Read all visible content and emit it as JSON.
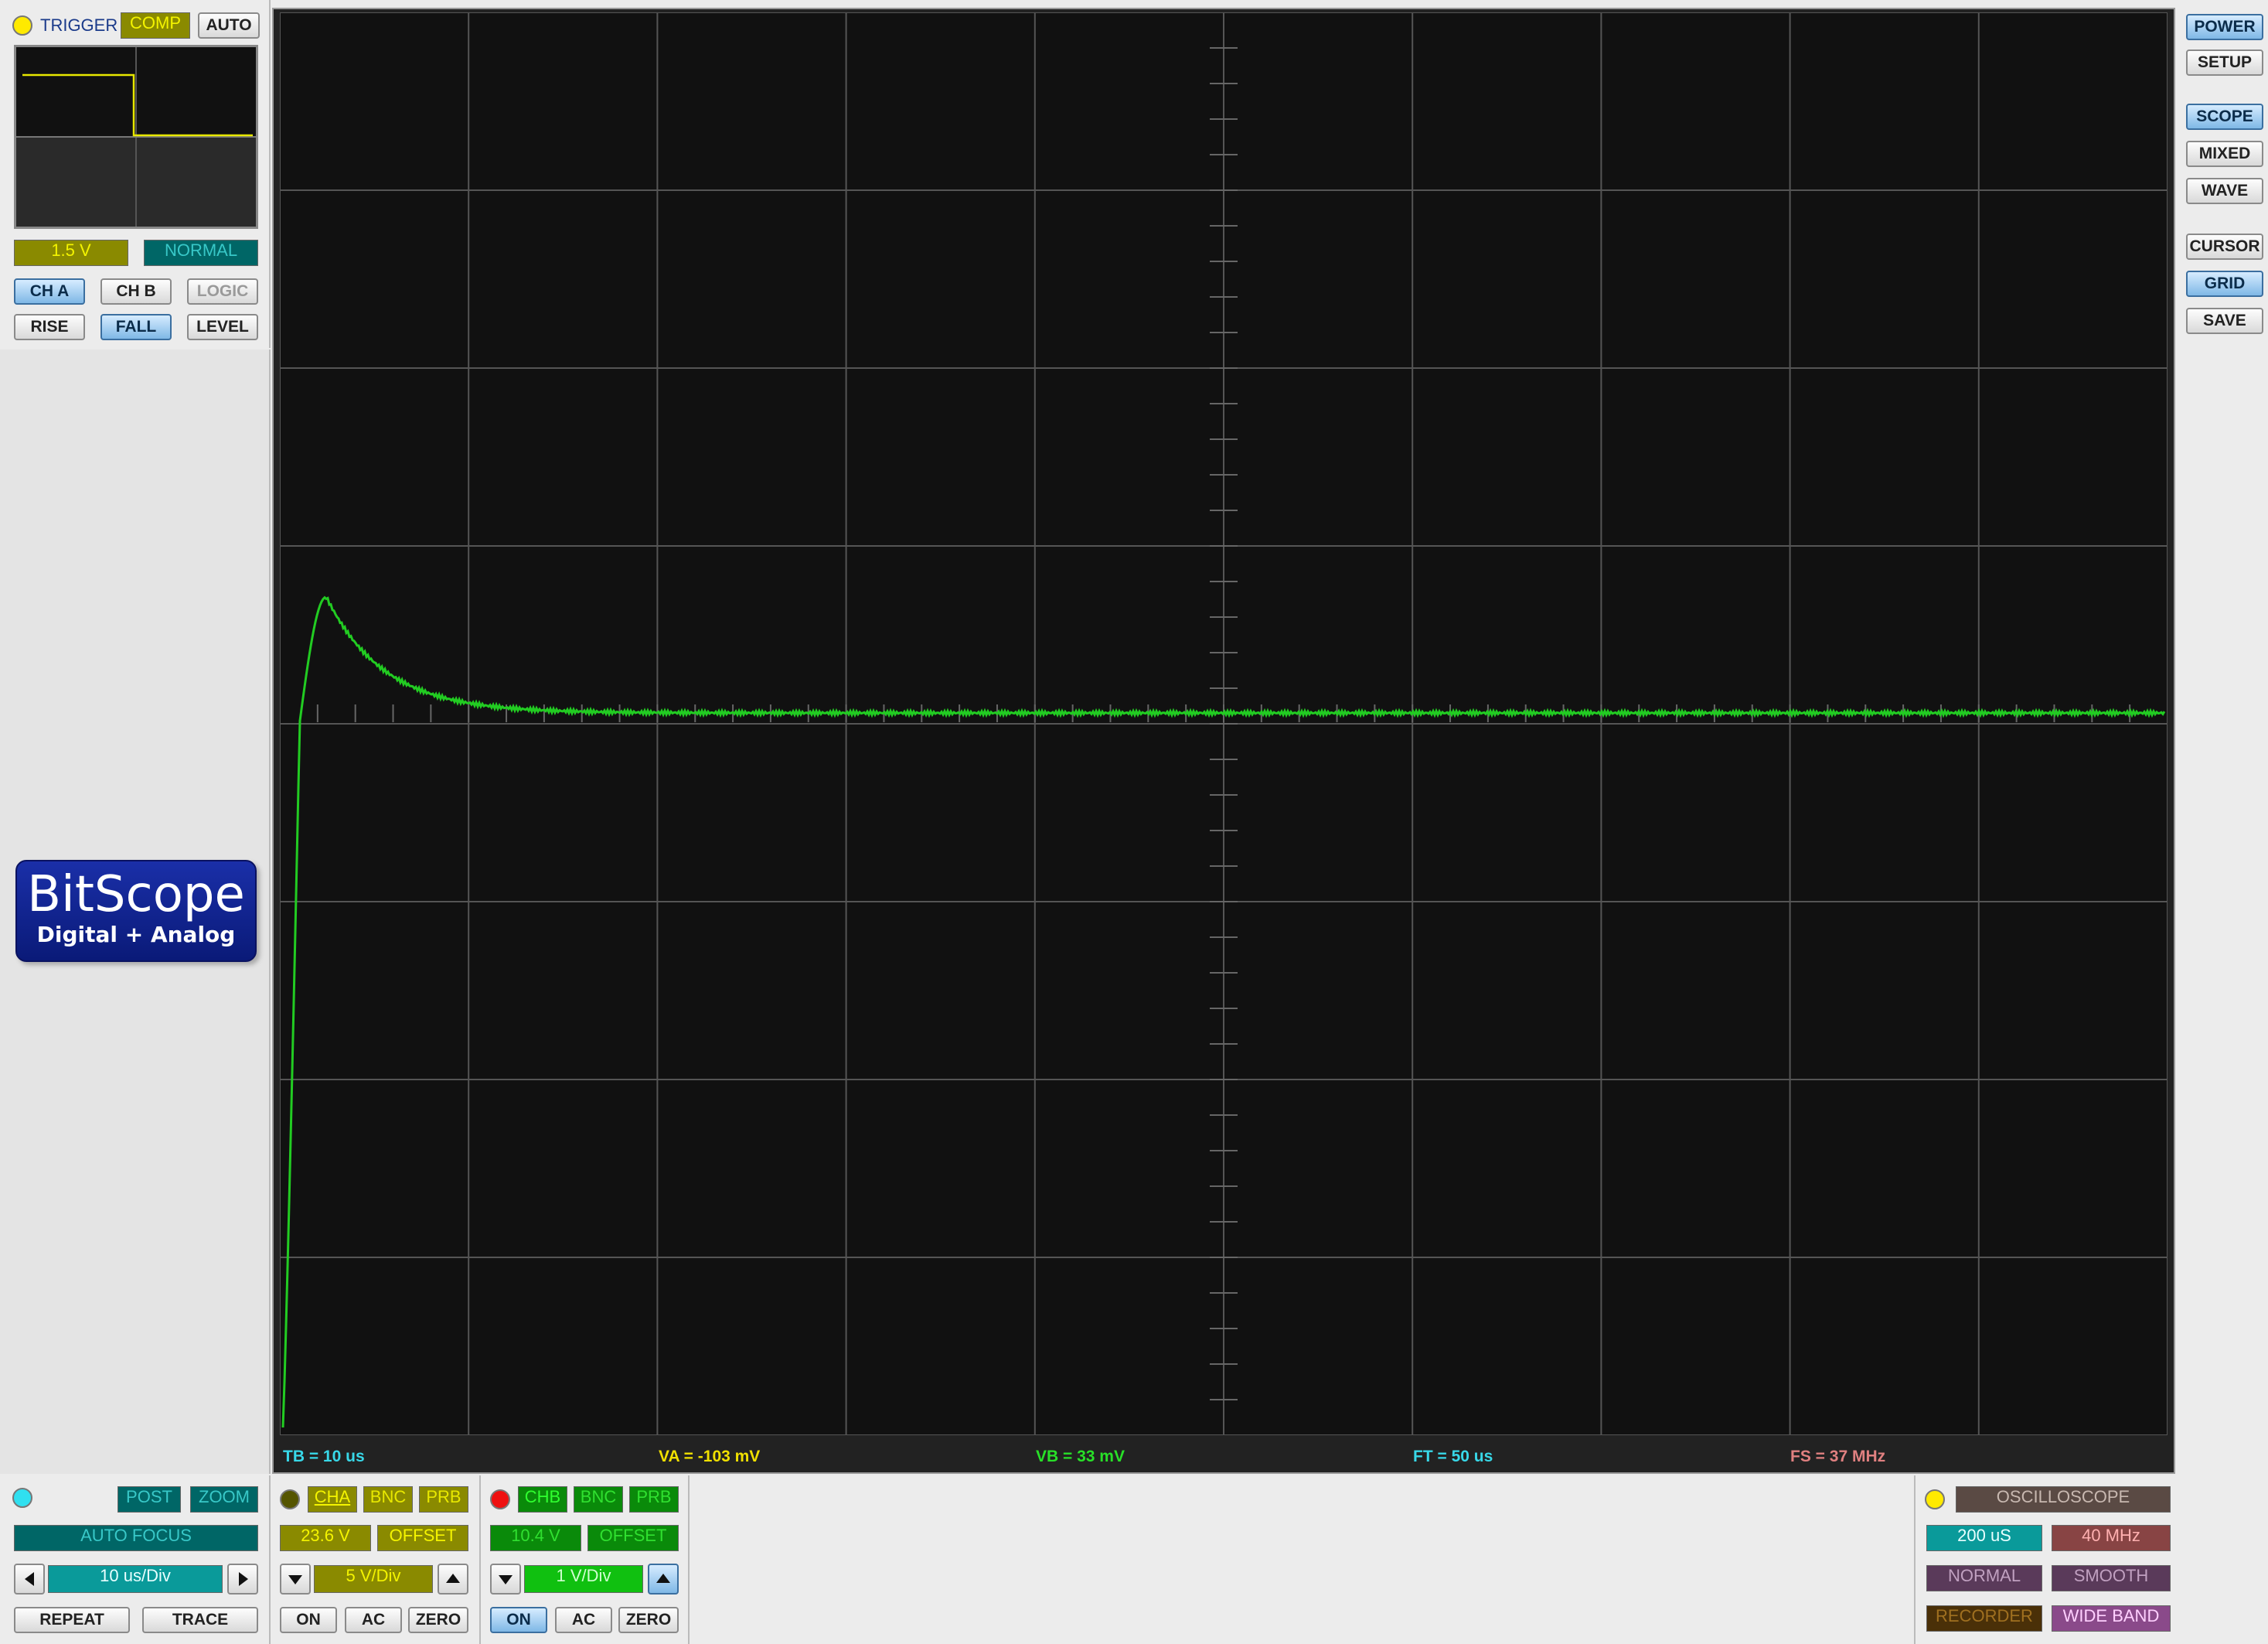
{
  "trigger": {
    "title": "TRIGGER",
    "comp": "COMP",
    "auto": "AUTO",
    "level": "1.5 V",
    "mode": "NORMAL",
    "ch_a": "CH A",
    "ch_b": "CH B",
    "logic": "LOGIC",
    "rise": "RISE",
    "fall": "FALL",
    "level_btn": "LEVEL"
  },
  "logo": {
    "title": "BitScope",
    "subtitle": "Digital + Analog"
  },
  "right_menu": {
    "power": "POWER",
    "setup": "SETUP",
    "scope": "SCOPE",
    "mixed": "MIXED",
    "wave": "WAVE",
    "cursor": "CURSOR",
    "grid": "GRID",
    "save": "SAVE"
  },
  "measurements": {
    "tb": "TB = 10 us",
    "va": "VA = -103 mV",
    "vb": "VB = 33 mV",
    "ft": "FT = 50 us",
    "fs": "FS = 37 MHz"
  },
  "timebase": {
    "post": "POST",
    "zoom": "ZOOM",
    "auto_focus": "AUTO FOCUS",
    "value": "10 us/Div",
    "repeat": "REPEAT",
    "trace": "TRACE"
  },
  "channel_a": {
    "name": "CHA",
    "bnc": "BNC",
    "prb": "PRB",
    "range": "23.6 V",
    "offset": "OFFSET",
    "scale": "5 V/Div",
    "on": "ON",
    "ac": "AC",
    "zero": "ZERO"
  },
  "channel_b": {
    "name": "CHB",
    "bnc": "BNC",
    "prb": "PRB",
    "range": "10.4 V",
    "offset": "OFFSET",
    "scale": "1 V/Div",
    "on": "ON",
    "ac": "AC",
    "zero": "ZERO"
  },
  "capture": {
    "mode": "OSCILLOSCOPE",
    "duration": "200 uS",
    "rate": "40 MHz",
    "normal": "NORMAL",
    "smooth": "SMOOTH",
    "recorder": "RECORDER",
    "wide_band": "WIDE BAND"
  },
  "colors": {
    "trace_a": "#22cc22",
    "trigger": "#f0f000",
    "screen_bg": "#111111",
    "grid": "#555555"
  }
}
